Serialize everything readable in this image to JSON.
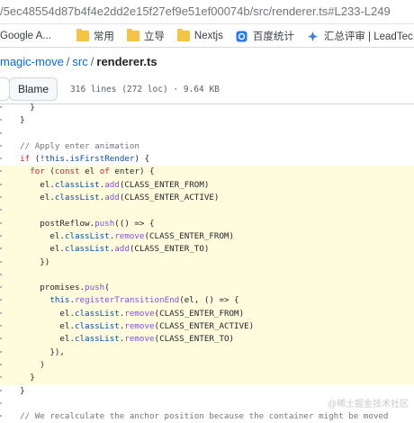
{
  "browser": {
    "url": "/5ec48554d87b4f4e2dd2e15f27ef9e51ef00074b/src/renderer.ts#L233-L249",
    "bookmarks": [
      {
        "label": "Google A...",
        "icon": "google-icon"
      },
      {
        "label": "常用",
        "icon": "folder-icon"
      },
      {
        "label": "立导",
        "icon": "folder-icon"
      },
      {
        "label": "Nextjs",
        "icon": "folder-icon"
      },
      {
        "label": "百度统计",
        "icon": "baidu-stats-icon"
      },
      {
        "label": "汇总评审 | LeadTec...",
        "icon": "leadtec-icon"
      }
    ]
  },
  "breadcrumb": {
    "repo": "magic-move",
    "dir": "src",
    "file": "renderer.ts",
    "separator": "/"
  },
  "toolbar": {
    "blame_label": "Blame",
    "file_info": "316 lines (272 loc) · 9.64 KB"
  },
  "code": {
    "highlight_color": "#fffbdd",
    "lines": [
      {
        "text": "      }",
        "hl": false
      },
      {
        "text": "    }",
        "hl": false
      },
      {
        "text": "",
        "hl": false
      },
      {
        "text": "    // Apply enter animation",
        "hl": false
      },
      {
        "text": "    if (!this.isFirstRender) {",
        "hl": false
      },
      {
        "text": "      for (const el of enter) {",
        "hl": true
      },
      {
        "text": "        el.classList.add(CLASS_ENTER_FROM)",
        "hl": true
      },
      {
        "text": "        el.classList.add(CLASS_ENTER_ACTIVE)",
        "hl": true
      },
      {
        "text": "",
        "hl": true
      },
      {
        "text": "        postReflow.push(() => {",
        "hl": true
      },
      {
        "text": "          el.classList.remove(CLASS_ENTER_FROM)",
        "hl": true
      },
      {
        "text": "          el.classList.add(CLASS_ENTER_TO)",
        "hl": true
      },
      {
        "text": "        })",
        "hl": true
      },
      {
        "text": "",
        "hl": true
      },
      {
        "text": "        promises.push(",
        "hl": true
      },
      {
        "text": "          this.registerTransitionEnd(el, () => {",
        "hl": true
      },
      {
        "text": "            el.classList.remove(CLASS_ENTER_FROM)",
        "hl": true
      },
      {
        "text": "            el.classList.remove(CLASS_ENTER_ACTIVE)",
        "hl": true
      },
      {
        "text": "            el.classList.remove(CLASS_ENTER_TO)",
        "hl": true
      },
      {
        "text": "          }),",
        "hl": true
      },
      {
        "text": "        )",
        "hl": true
      },
      {
        "text": "      }",
        "hl": true
      },
      {
        "text": "    }",
        "hl": false
      },
      {
        "text": "",
        "hl": false
      },
      {
        "text": "    // We recalculate the anchor position because the container might be moved",
        "hl": false
      }
    ]
  },
  "watermark": "@稀土掘金技术社区"
}
